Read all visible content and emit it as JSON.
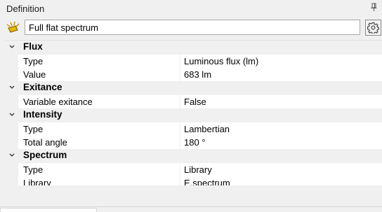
{
  "panel": {
    "title": "Definition",
    "pin_icon": "pin-icon"
  },
  "source": {
    "icon": "light-source-icon",
    "name": "Full flat spectrum",
    "settings_icon": "gear-icon"
  },
  "categories": [
    {
      "label": "Flux",
      "properties": [
        {
          "name": "Type",
          "value": "Luminous flux (lm)"
        },
        {
          "name": "Value",
          "value": "683 lm"
        }
      ]
    },
    {
      "label": "Exitance",
      "properties": [
        {
          "name": "Variable exitance",
          "value": "False"
        }
      ]
    },
    {
      "label": "Intensity",
      "properties": [
        {
          "name": "Type",
          "value": "Lambertian"
        },
        {
          "name": "Total angle",
          "value": "180 °"
        }
      ]
    },
    {
      "label": "Spectrum",
      "properties": [
        {
          "name": "Type",
          "value": "Library"
        },
        {
          "name": "Library",
          "value": "E.spectrum"
        }
      ]
    }
  ]
}
